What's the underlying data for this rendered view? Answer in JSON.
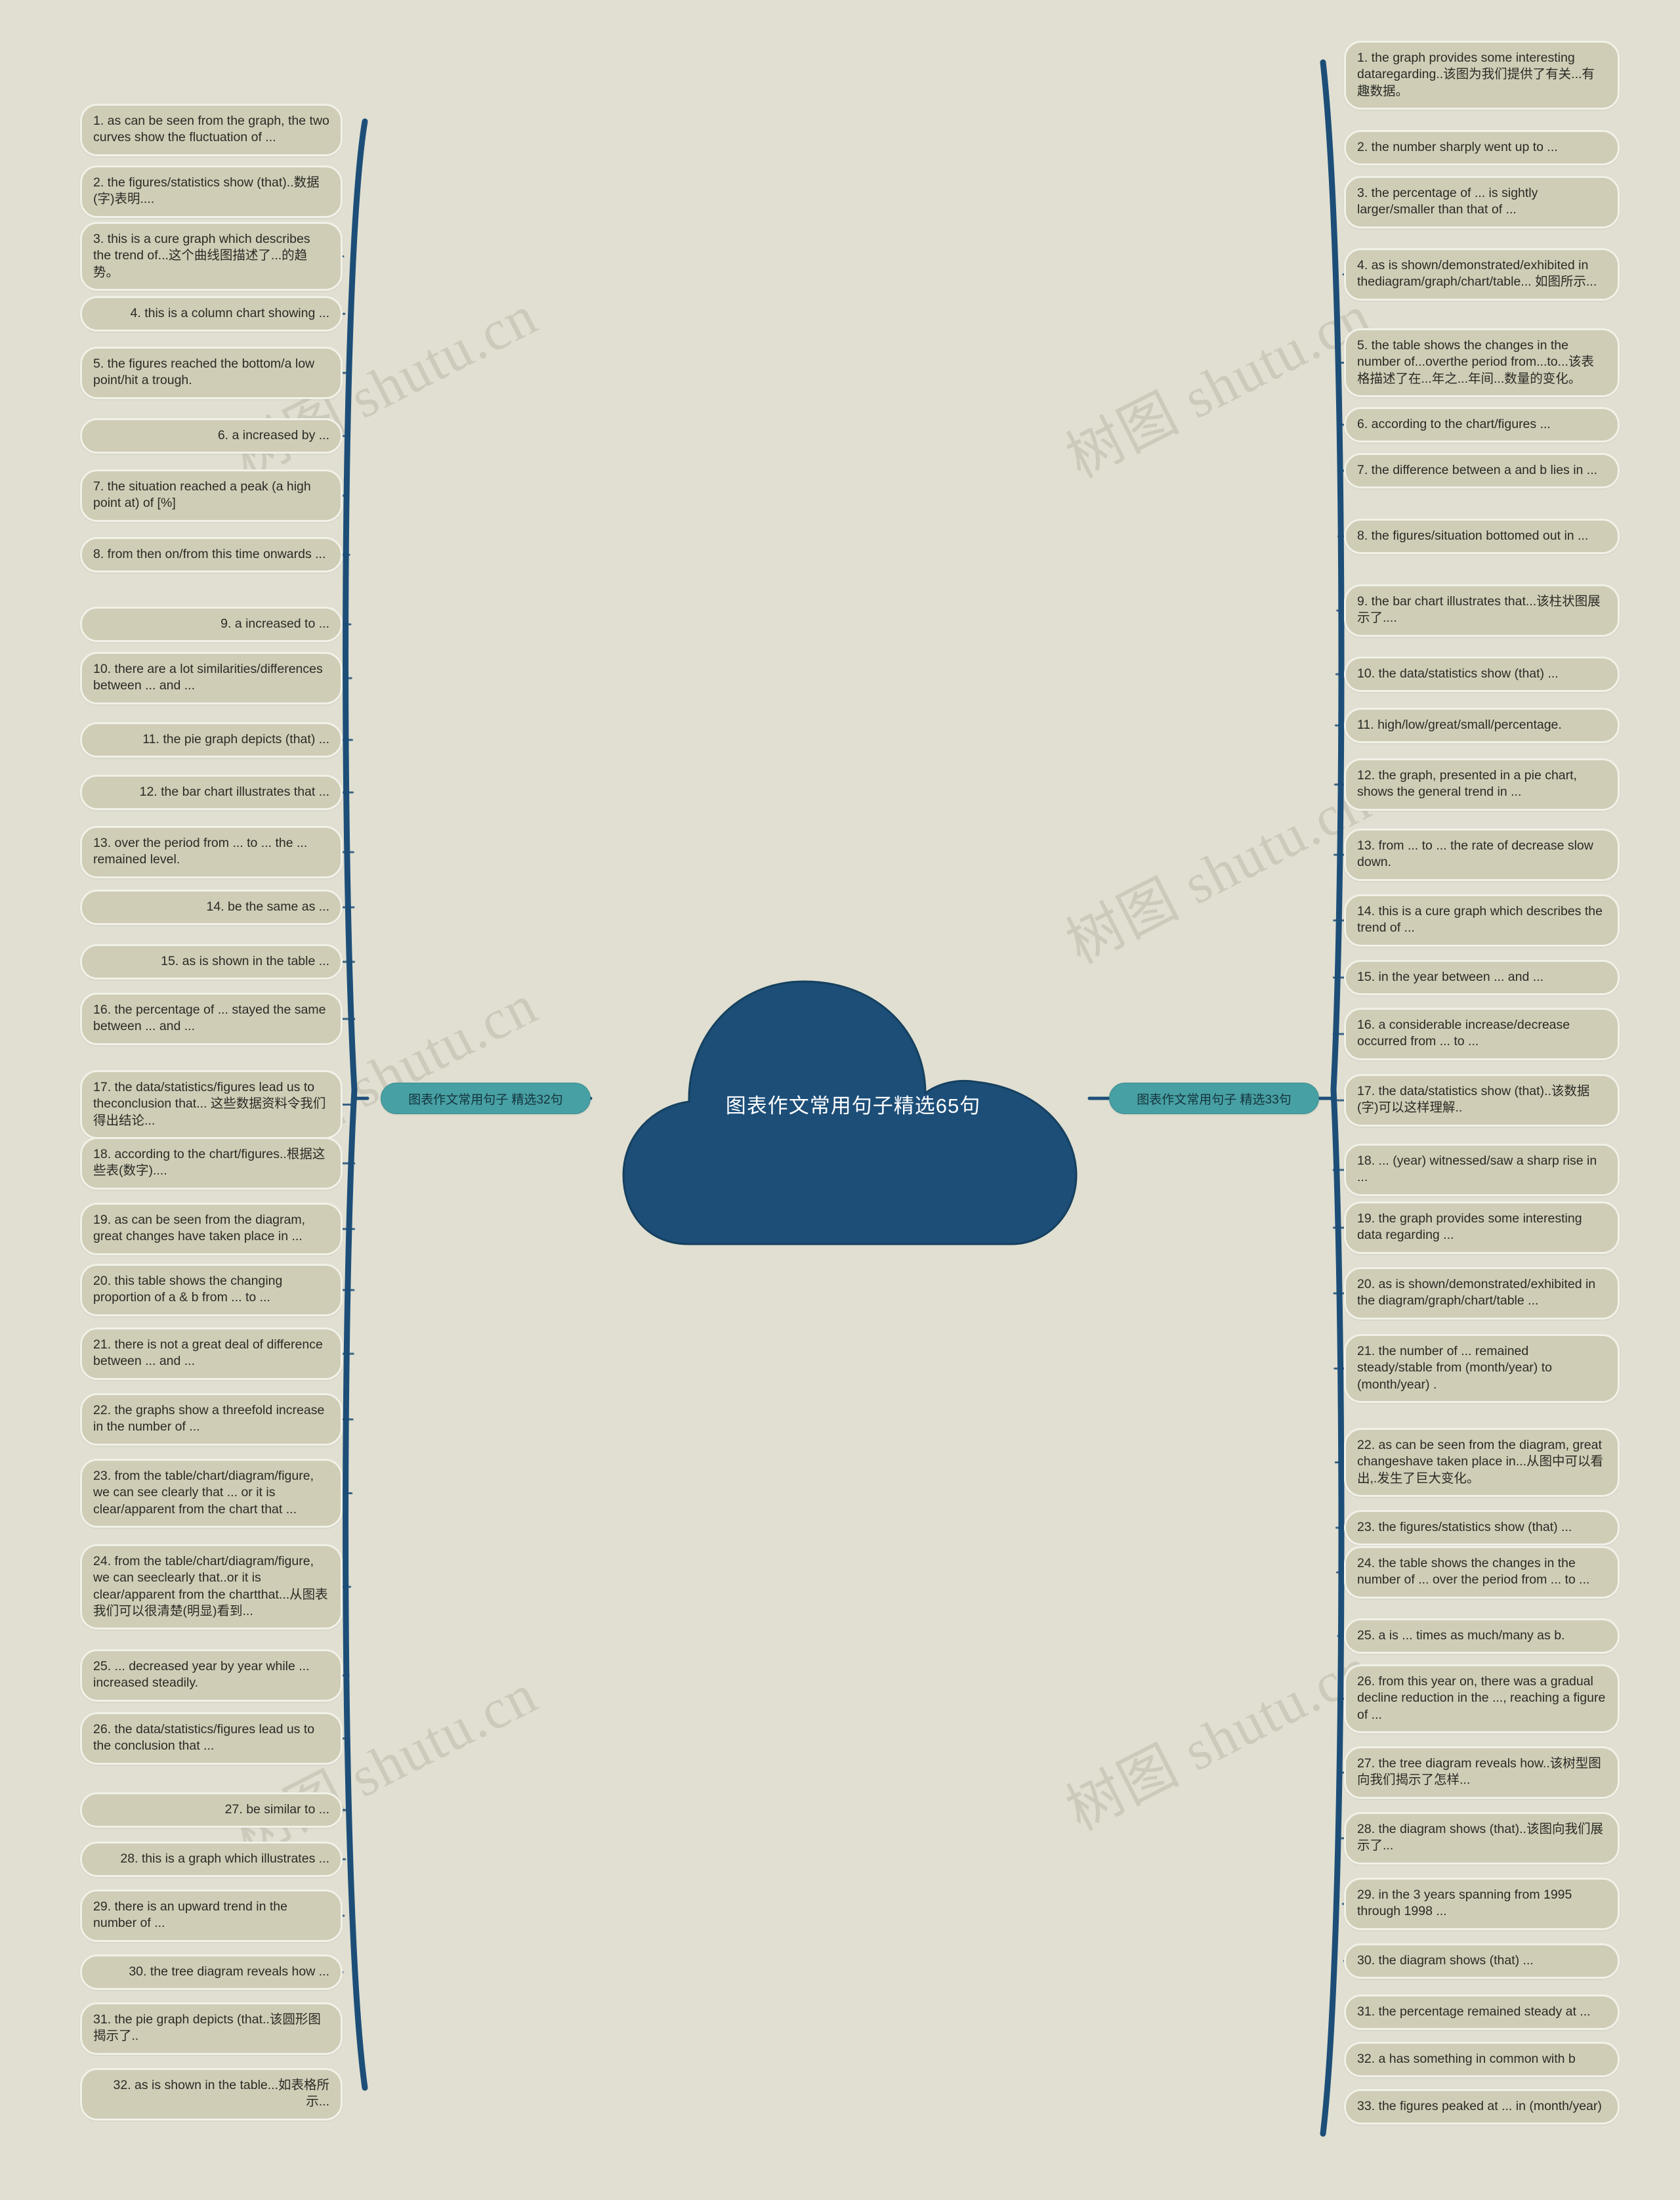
{
  "background_color": "#e0dfd1",
  "node_color": "#cfcdb6",
  "branch_color": "#47a0a3",
  "root_color": "#1c4e78",
  "watermarks": [
    "树图 shutu.cn",
    "树图 shutu.cn",
    "树图 shutu.cn",
    "树图 shutu.cn",
    "树图 shutu.cn",
    "树图 shutu.cn"
  ],
  "root": {
    "title": "图表作文常用句子精选65句",
    "shape": "cloud"
  },
  "branches": [
    {
      "id": "left",
      "label": "图表作文常用句子 精选32句"
    },
    {
      "id": "right",
      "label": "图表作文常用句子 精选33句"
    }
  ],
  "left_items": [
    "1. as can be seen from the graph, the two curves show the fluctuation of ...",
    "2. the figures/statistics show (that)..数据(字)表明....",
    "3. this is a cure graph which describes the trend of...这个曲线图描述了...的趋势。",
    "4. this is a column chart showing ...",
    "5. the figures reached the bottom/a low point/hit a trough.",
    "6. a increased by ...",
    "7. the situation reached a peak (a high point at) of [%]",
    "8. from then on/from this time onwards ...",
    "9. a increased to ...",
    "10. there are a lot similarities/differences between ... and ...",
    "11. the pie graph depicts (that) ...",
    "12. the bar chart illustrates that ...",
    "13. over the period from ... to ... the ... remained level.",
    "14. be the same as ...",
    "15. as is shown in the table ...",
    "16. the percentage of ... stayed the same between ... and ...",
    "17. the data/statistics/figures lead us to theconclusion that... 这些数据资料令我们得出结论...",
    "18. according to the chart/figures..根据这些表(数字)....",
    "19. as can be seen from the diagram, great changes have taken place in ...",
    "20. this table shows the changing proportion of a & b from ... to ...",
    "21. there is not a great deal of difference between ... and ...",
    "22. the graphs show a threefold increase in the number of ...",
    "23. from the table/chart/diagram/figure, we can see clearly that ... or it is clear/apparent from the chart that ...",
    "24. from the table/chart/diagram/figure, we can seeclearly that..or it is clear/apparent from the chartthat...从图表我们可以很清楚(明显)看到...",
    "25. ... decreased year by year while ... increased steadily.",
    "26. the data/statistics/figures lead us to the conclusion that ...",
    "27. be similar to ...",
    "28. this is a graph which illustrates ...",
    "29. there is an upward trend in the number of ...",
    "30. the tree diagram reveals how ...",
    "31. the pie graph depicts (that..该圆形图揭示了..",
    "32. as is shown in the table...如表格所示..."
  ],
  "right_items": [
    "1. the graph provides some interesting dataregarding..该图为我们提供了有关...有趣数据。",
    "2. the number sharply went up to ...",
    "3. the percentage of ... is sightly larger/smaller than that of ...",
    "4. as is shown/demonstrated/exhibited in thediagram/graph/chart/table... 如图所示...",
    "5. the table shows the changes in the number of...overthe period from...to...该表格描述了在...年之...年间...数量的变化。",
    "6. according to the chart/figures ...",
    "7. the difference between a and b lies in ...",
    "8. the figures/situation bottomed out in ...",
    "9. the bar chart illustrates that...该柱状图展示了....",
    "10. the data/statistics show (that) ...",
    "11. high/low/great/small/percentage.",
    "12. the graph, presented in a pie chart, shows the general trend in ...",
    "13. from ... to ... the rate of decrease slow down.",
    "14. this is a cure graph which describes the trend of ...",
    "15. in the year between ... and ...",
    "16. a considerable increase/decrease occurred from ... to ...",
    "17. the data/statistics show (that)..该数据(字)可以这样理解..",
    "18. ... (year) witnessed/saw a sharp rise in ...",
    "19. the graph provides some interesting data regarding ...",
    "20. as is shown/demonstrated/exhibited in the diagram/graph/chart/table ...",
    "21. the number of ... remained steady/stable from (month/year) to (month/year) .",
    "22. as can be seen from the diagram, great changeshave taken place in...从图中可以看出,.发生了巨大变化。",
    "23. the figures/statistics show (that) ...",
    "24. the table shows the changes in the number of ... over the period from ... to ...",
    "25. a is ... times as much/many as b.",
    "26. from this year on, there was a gradual decline reduction in the ..., reaching a figure of ...",
    "27. the tree diagram reveals how..该树型图向我们揭示了怎样...",
    "28. the diagram shows (that)..该图向我们展示了...",
    "29. in the 3 years spanning from 1995 through 1998 ...",
    "30. the diagram shows (that) ...",
    "31. the percentage remained steady at ...",
    "32. a has something in common with b",
    "33. the figures peaked at ... in (month/year)"
  ]
}
